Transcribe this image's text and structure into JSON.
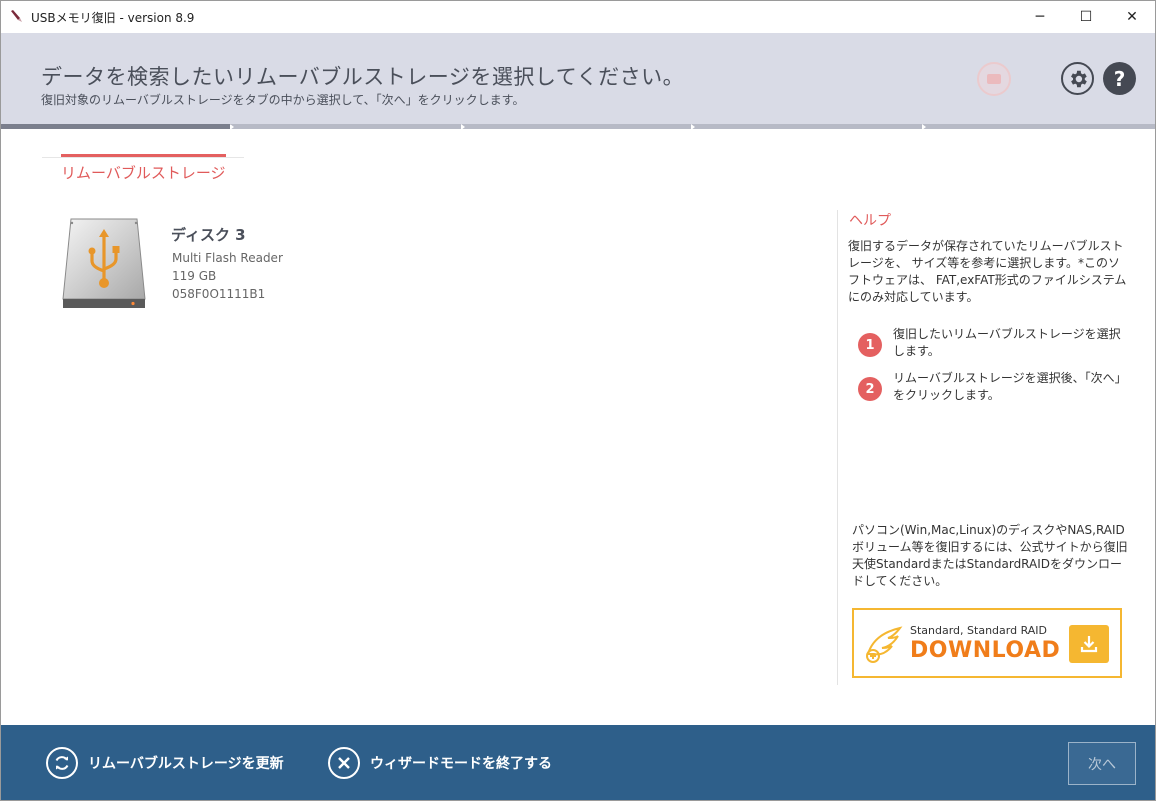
{
  "window": {
    "title": "USBメモリ復旧 - version 8.9",
    "controls": {
      "minimize": "─",
      "maximize": "☐",
      "close": "✕"
    }
  },
  "header": {
    "title": "データを検索したいリムーバブルストレージを選択してください。",
    "subtitle": "復旧対象のリムーバブルストレージをタブの中から選択して、「次へ」をクリックします。",
    "help_label": "?"
  },
  "progress": {
    "current_step": 1,
    "total_steps": 5
  },
  "tab": {
    "label": "リムーバブルストレージ"
  },
  "disk": {
    "name": "ディスク 3",
    "model": "Multi Flash Reader",
    "size": "119 GB",
    "serial": "058F0O1111B1"
  },
  "help": {
    "title": "ヘルプ",
    "description": "復旧するデータが保存されていたリムーバブルストレージを、 サイズ等を参考に選択します。*このソフトウェアは、 FAT,exFAT形式のファイルシステムにのみ対応しています。",
    "steps": [
      {
        "num": "1",
        "text": "復旧したいリムーバブルストレージを選択します。"
      },
      {
        "num": "2",
        "text": "リムーバブルストレージを選択後、「次へ」をクリックします。"
      }
    ],
    "promo": "パソコン(Win,Mac,Linux)のディスクやNAS,RAIDボリューム等を復旧するには、公式サイトから復旧天使StandardまたはStandardRAIDをダウンロードしてください。",
    "download": {
      "small": "Standard, Standard RAID",
      "big": "DOWNLOAD"
    }
  },
  "footer": {
    "refresh_label": "リムーバブルストレージを更新",
    "exit_label": "ウィザードモードを終了する",
    "next_label": "次へ"
  },
  "colors": {
    "accent_red": "#e46060",
    "header_bg": "#d9dbe6",
    "footer_bg": "#2e5f8a",
    "download_orange": "#f5b731"
  }
}
